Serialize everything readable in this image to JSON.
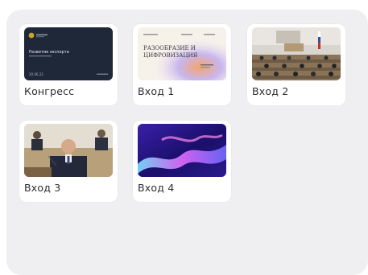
{
  "inputs": [
    {
      "label": "Конгресс",
      "thumbnail": {
        "kind": "title-slide",
        "heading": "Развитие экспорта",
        "date": "20.06.22"
      }
    },
    {
      "label": "Вход 1",
      "thumbnail": {
        "kind": "banner-slide",
        "heading_lines": [
          "РАЗООБРАЗИЕ И",
          "ЦИФРОВИЗАЦИЯ"
        ]
      }
    },
    {
      "label": "Вход 2",
      "thumbnail": {
        "kind": "camera-hall"
      }
    },
    {
      "label": "Вход 3",
      "thumbnail": {
        "kind": "camera-speaker"
      }
    },
    {
      "label": "Вход 4",
      "thumbnail": {
        "kind": "abstract-wallpaper"
      }
    }
  ],
  "colors": {
    "panel": "#efeff1",
    "card": "#ffffff",
    "label_text": "#2e2e32",
    "slide_dark": "#1f2a3a",
    "slide_accent": "#c9a227"
  }
}
